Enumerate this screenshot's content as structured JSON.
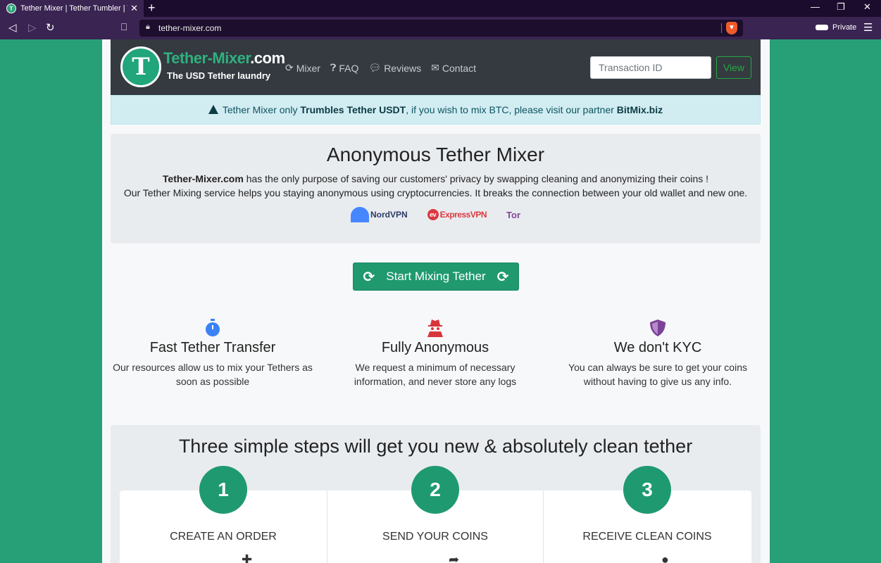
{
  "browser": {
    "tab_title": "Tether Mixer | Tether Tumbler | Tether",
    "url": "tether-mixer.com",
    "private_label": "Private"
  },
  "header": {
    "logo_name": "Tether-Mixer",
    "logo_suffix": ".com",
    "logo_tagline": "The USD Tether laundry",
    "nav": [
      {
        "label": "Mixer",
        "icon": "refresh-icon"
      },
      {
        "label": "FAQ",
        "icon": "question-icon"
      },
      {
        "label": "Reviews",
        "icon": "comments-icon"
      },
      {
        "label": "Contact",
        "icon": "envelope-icon"
      }
    ],
    "tx_placeholder": "Transaction ID",
    "view_label": "View"
  },
  "alert": {
    "prefix": "Tether Mixer only ",
    "bold1": "Trumbles Tether USDT",
    "middle": ", if you wish to mix BTC, please visit our partner ",
    "bold2": "BitMix.biz"
  },
  "jumbo": {
    "title": "Anonymous Tether Mixer",
    "brand": "Tether-Mixer.com",
    "line1_rest": " has the only purpose of saving our customers' privacy by swapping cleaning and anonymizing their coins !",
    "line2": "Our Tether Mixing service helps you staying anonymous using cryptocurrencies. It breaks the connection between your old wallet and new one.",
    "partners": [
      "NordVPN",
      "ExpressVPN",
      "Tor"
    ]
  },
  "start_button": "Start Mixing Tether",
  "features": [
    {
      "title": "Fast Tether Transfer",
      "text": "Our resources allow us to mix your Tethers as soon as possible",
      "icon": "stopwatch-icon",
      "color": "#3b82f6"
    },
    {
      "title": "Fully Anonymous",
      "text": "We request a minimum of necessary information, and never store any logs",
      "icon": "spy-icon",
      "color": "#d9343a"
    },
    {
      "title": "We don't KYC",
      "text": "You can always be sure to get your coins without having to give us any info.",
      "icon": "shield-icon",
      "color": "#7b4397"
    }
  ],
  "steps": {
    "title": "Three simple steps will get you new & absolutely clean tether",
    "items": [
      {
        "num": "1",
        "label": "CREATE AN ORDER",
        "icon": "plus-icon"
      },
      {
        "num": "2",
        "label": "SEND YOUR COINS",
        "icon": "share-arrow-icon"
      },
      {
        "num": "3",
        "label": "RECEIVE CLEAN COINS",
        "icon": "tether-coin-icon"
      }
    ]
  }
}
